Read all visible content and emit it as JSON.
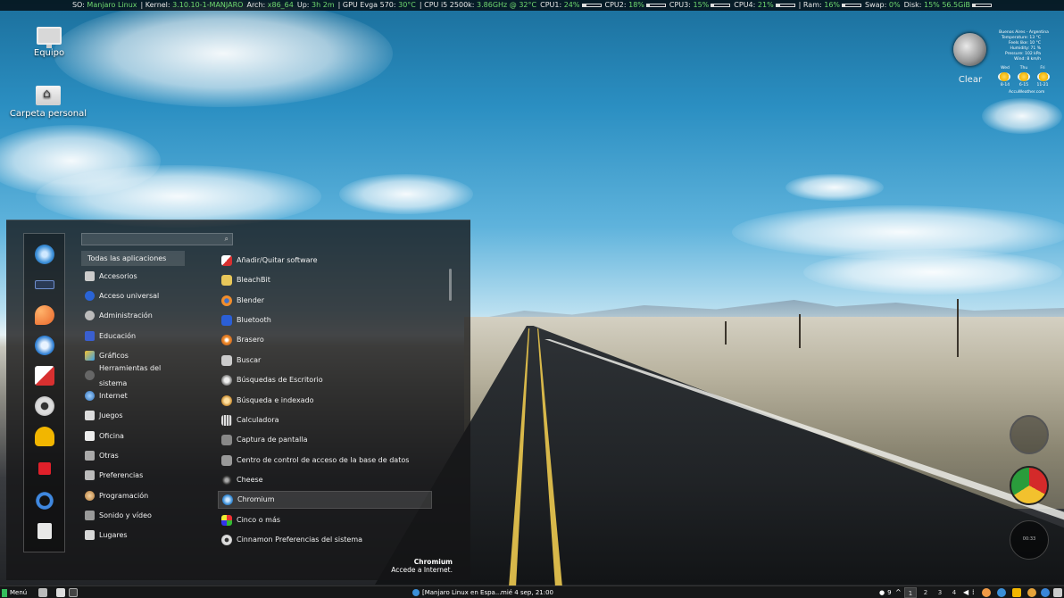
{
  "conky": {
    "os_label": "SO:",
    "os_value": "Manjaro Linux",
    "kernel_label": "| Kernel:",
    "kernel_value": "3.10.10-1-MANJARO",
    "arch_label": "Arch:",
    "arch_value": "x86_64",
    "up_label": "Up:",
    "up_value": "3h 2m",
    "gpu_label": "| GPU Evga 570:",
    "gpu_value": "30°C",
    "cpu_label": "| CPU i5 2500k:",
    "cpu_value": "3.86GHz @ 32°C",
    "cpu1_label": "CPU1:",
    "cpu1_value": "24%",
    "cpu1_fraction": 0.24,
    "cpu2_label": "CPU2:",
    "cpu2_value": "18%",
    "cpu2_fraction": 0.18,
    "cpu3_label": "CPU3:",
    "cpu3_value": "15%",
    "cpu3_fraction": 0.15,
    "cpu4_label": "CPU4:",
    "cpu4_value": "21%",
    "cpu4_fraction": 0.21,
    "ram_label": "| Ram:",
    "ram_value": "16%",
    "ram_fraction": 0.16,
    "swap_label": "Swap:",
    "swap_value": "0%",
    "disk_label": "Disk:",
    "disk_value": "15% 56.5GiB",
    "disk_fraction": 0.15
  },
  "desktop": {
    "computer_label": "Equipo",
    "home_label": "Carpeta personal"
  },
  "weather": {
    "condition": "Clear",
    "city": "Buenos Aires - Argentina",
    "temperature": "Temperature: 13 °C",
    "feels_like": "Feels like: 10 °C",
    "humidity": "Humidity: 71 %",
    "pressure": "Pressure: 102 kPa",
    "wind": "Wind: 8 km/h",
    "days": [
      "Wed",
      "Thu",
      "Fri"
    ],
    "temps": [
      "8-14",
      "6-15",
      "11-21"
    ],
    "source": "AccuWeather.com"
  },
  "menu": {
    "search_placeholder": "",
    "categories": [
      "Todas las aplicaciones",
      "Accesorios",
      "Acceso universal",
      "Administración",
      "Educación",
      "Gráficos",
      "Herramientas del sistema",
      "Internet",
      "Juegos",
      "Oficina",
      "Otras",
      "Preferencias",
      "Programación",
      "Sonido y vídeo",
      "Lugares"
    ],
    "apps": [
      "Añadir/Quitar software",
      "BleachBit",
      "Blender",
      "Bluetooth",
      "Brasero",
      "Buscar",
      "Búsquedas de Escritorio",
      "Búsqueda e indexado",
      "Calculadora",
      "Captura de pantalla",
      "Centro de control de acceso de la base de datos",
      "Cheese",
      "Chromium",
      "Cinco o más",
      "Cinnamon Preferencias del sistema"
    ],
    "selected_title": "Chromium",
    "selected_desc": "Accede a Internet."
  },
  "panel": {
    "menu_label": "Menú",
    "task_label": "[Manjaro Linux en Espa...",
    "datetime": "mié 4 sep, 21:00",
    "notif_count": "9",
    "workspaces": [
      "1",
      "2",
      "3",
      "4"
    ]
  },
  "clock_widget": {
    "time": "00:33"
  },
  "colors": {
    "accent_green": "#6fd86f",
    "menu_bg": "#141416"
  }
}
